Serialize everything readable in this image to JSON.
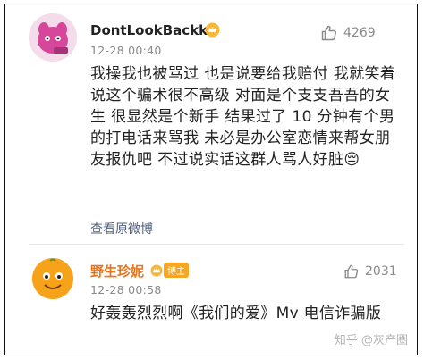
{
  "comments": [
    {
      "username": "DontLookBackkk",
      "timestamp": "12-28 00:40",
      "likes": "4269",
      "body": "我操我也被骂过 也是说要给我赔付 我就笑着说这个骗术很不高级 对面是个支支吾吾的女生 很显然是个新手 结果过了 10 分钟有个男的打电话来骂我 未必是办公室恋情来帮女朋友报仇吧 不过说实话这群人骂人好脏😔",
      "view_original": "查看原微博",
      "colors": {
        "username": "#222222"
      }
    },
    {
      "username": "野生珍妮",
      "badge_label": "博主",
      "timestamp": "12-28 00:58",
      "likes": "2031",
      "body": "好轰轰烈烈啊《我们的爱》Mv 电信诈骗版",
      "colors": {
        "username": "#e8741e"
      }
    }
  ],
  "watermark": "知乎 @灰产圈",
  "icons": {
    "like": "thumbs-up-icon",
    "avatar1": "pink-character-avatar",
    "avatar2": "orange-emoji-avatar",
    "vip": "vip-crown-icon"
  }
}
